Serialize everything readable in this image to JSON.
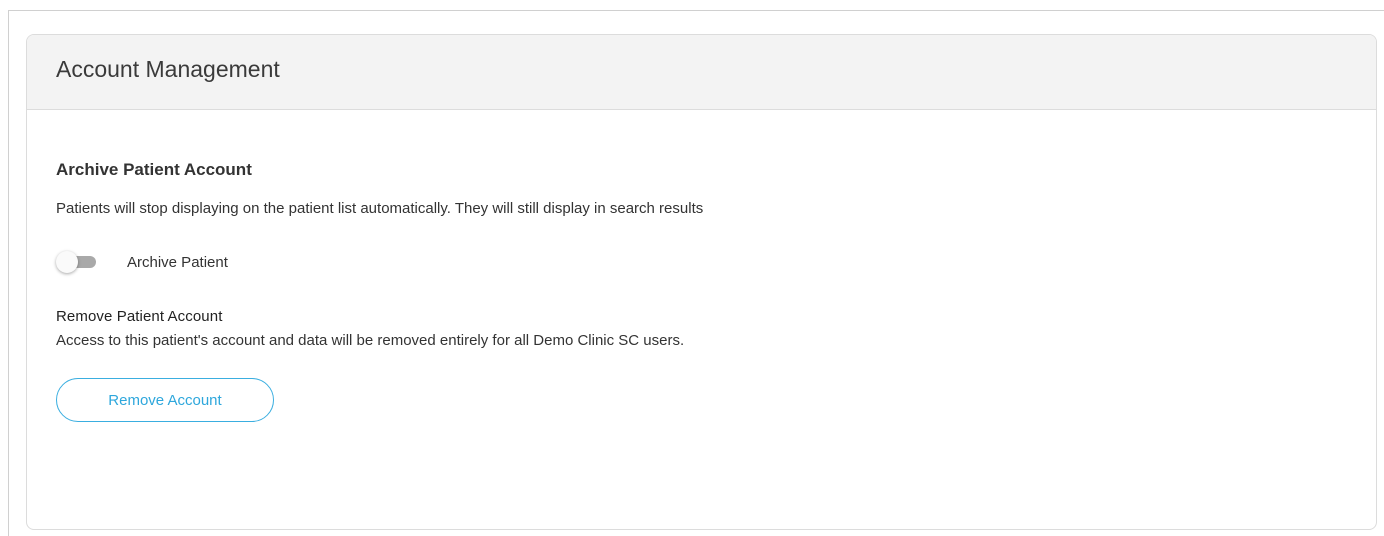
{
  "card": {
    "title": "Account Management"
  },
  "archive": {
    "title": "Archive Patient Account",
    "description": "Patients will stop displaying on the patient list automatically. They will still display in search results",
    "toggle_label": "Archive Patient",
    "toggle_on": false
  },
  "remove": {
    "title": "Remove Patient Account",
    "description": "Access to this patient's account and data will be removed entirely for all Demo Clinic SC users.",
    "button_label": "Remove Account"
  },
  "colors": {
    "accent": "#2ea7dc",
    "header_bg": "#f3f3f3",
    "toggle_track_off": "#a9a9a9"
  }
}
